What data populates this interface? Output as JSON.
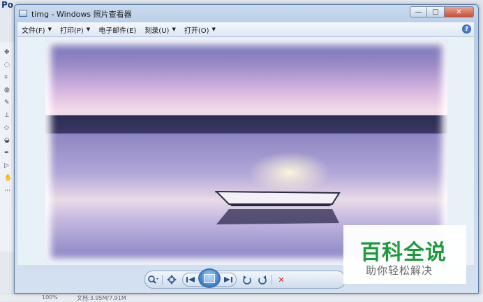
{
  "background_app": {
    "title": "Po",
    "status": [
      "100%",
      "文档:3.95M/7.91M"
    ]
  },
  "window": {
    "title": "timg - Windows 照片查看器",
    "caption": {
      "minimize": "—",
      "maximize": "□",
      "close": "✕"
    }
  },
  "menu": {
    "items": [
      {
        "label": "文件(F)"
      },
      {
        "label": "打印(P)"
      },
      {
        "label": "电子邮件(E)"
      },
      {
        "label": "刻录(U)"
      },
      {
        "label": "打开(O)"
      }
    ],
    "help": "?"
  },
  "icons": {
    "zoom": "magnifier-icon",
    "fit": "actual-size-icon",
    "prev": "previous-icon",
    "slideshow": "slideshow-icon",
    "next": "next-icon",
    "rotate_ccw": "rotate-counterclockwise-icon",
    "rotate_cw": "rotate-clockwise-icon",
    "delete": "delete-icon"
  },
  "watermark": {
    "logo": "百科全说",
    "subtitle": "助你轻松解决"
  },
  "colors": {
    "accent": "#2a4f85",
    "watermark_green": "#1d9a3c",
    "delete_red": "#c62828"
  }
}
